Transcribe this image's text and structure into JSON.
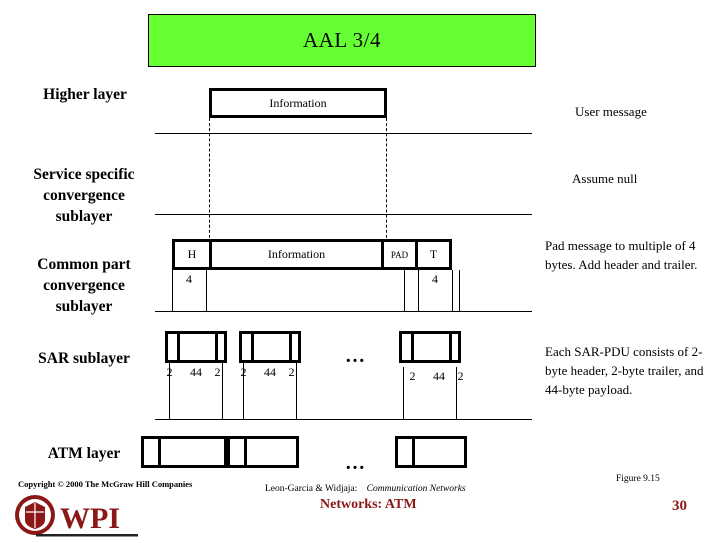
{
  "title": {
    "text": "AAL 3/4",
    "bg_color": "#66ff33"
  },
  "layers": [
    {
      "id": "higher-layer",
      "label": "Higher layer"
    },
    {
      "id": "service-specific-convergence-sublayer",
      "label": "Service specific\nconvergence\nsublayer"
    },
    {
      "id": "common-part-convergence-sublayer",
      "label": "Common part\nconvergence\nsublayer"
    },
    {
      "id": "sar-sublayer",
      "label": "SAR sublayer"
    },
    {
      "id": "atm-layer",
      "label": "ATM layer"
    }
  ],
  "notes": [
    {
      "id": "user-message",
      "text": "User message"
    },
    {
      "id": "assume-null",
      "text": "Assume null"
    },
    {
      "id": "pad-message",
      "text": "Pad message to multiple of 4 bytes.  Add header and trailer."
    },
    {
      "id": "sar-pdu-note",
      "text": "Each SAR-PDU consists of 2-byte header, 2-byte trailer, and 44-byte payload."
    }
  ],
  "higher_layer_pdu": {
    "label": "Information"
  },
  "cpcs_pdu": {
    "segments": [
      {
        "label": "H",
        "size": "4"
      },
      {
        "label": "Information",
        "size": ""
      },
      {
        "label": "PAD",
        "size": ""
      },
      {
        "label": "T",
        "size": "4"
      }
    ]
  },
  "sar_pdus": {
    "sizes": {
      "header": "2",
      "payload": "44",
      "trailer": "2"
    },
    "ellipsis": "…",
    "count_shown": 3
  },
  "atm_cells": {
    "ellipsis": "…",
    "count_shown": 3
  },
  "footer": {
    "copyright": "Copyright © 2000 The McGraw Hill Companies",
    "logo_text": "WPI",
    "book_authors": "Leon-Garcia & Widjaja:",
    "book_title": "Communication Networks",
    "chapter": "Networks: ATM",
    "figure": "Figure 9.15",
    "page": "30",
    "accent_color": "#8c1717"
  }
}
